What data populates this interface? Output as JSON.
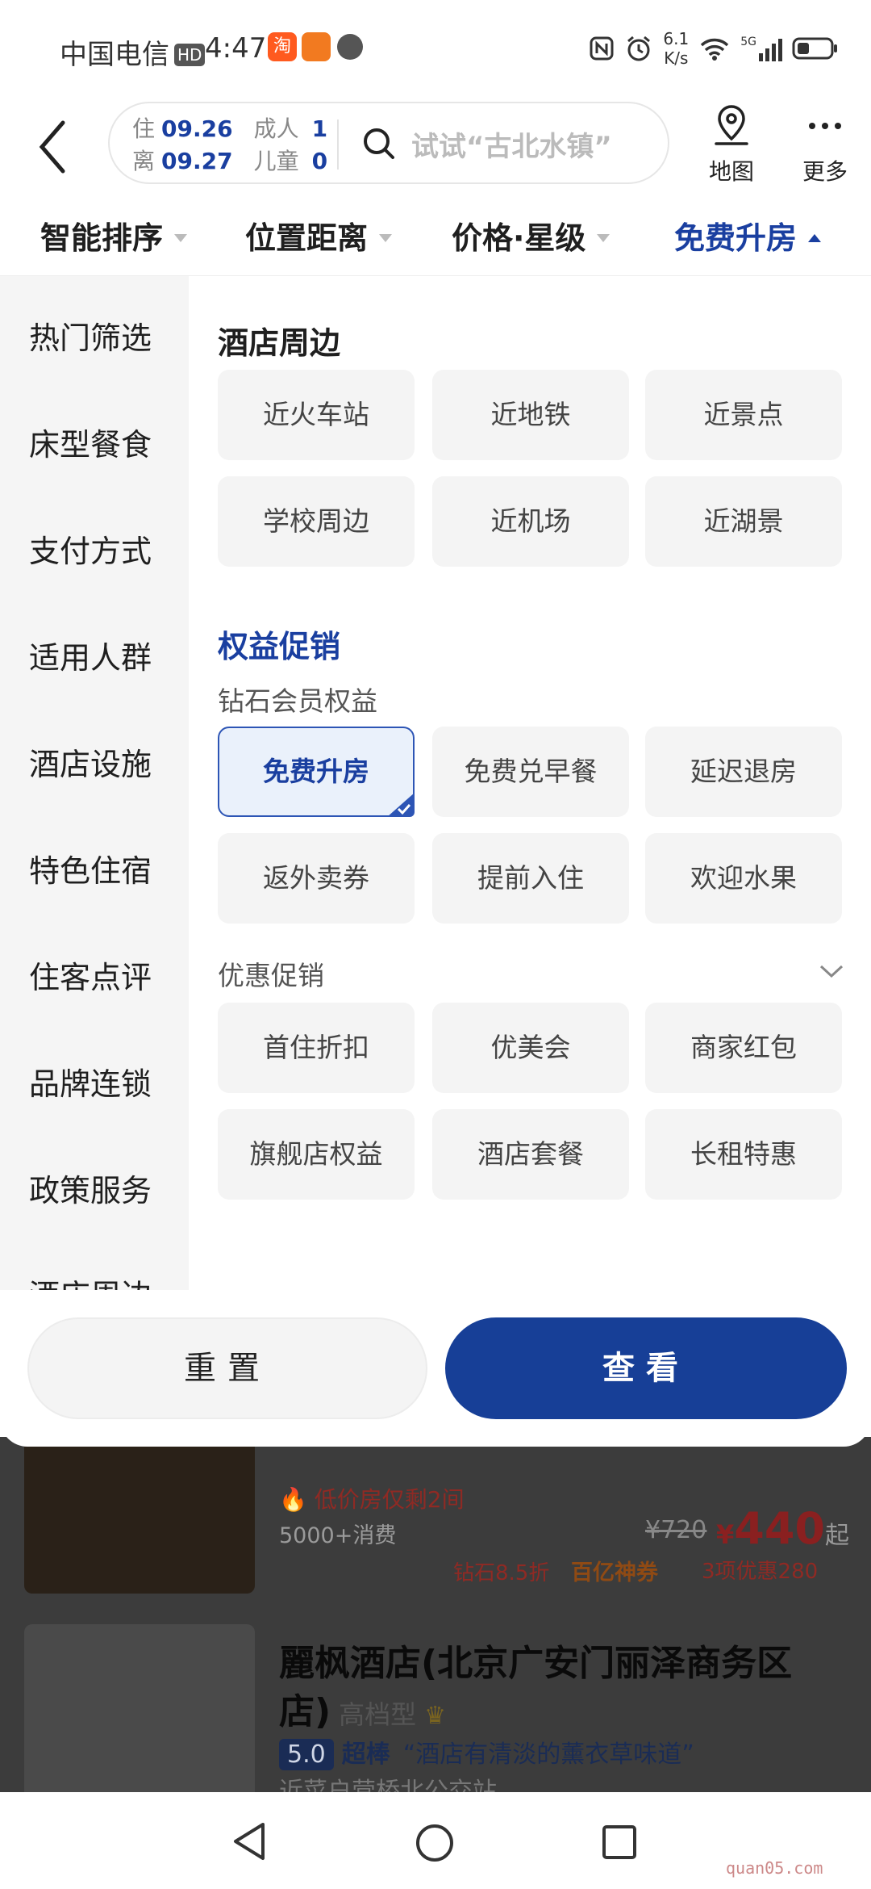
{
  "status_bar": {
    "carrier": "中国电信",
    "hd": "HD",
    "time": "4:47",
    "app_icon_1": "淘",
    "app_icon_2": "",
    "net_speed_value": "6.1",
    "net_speed_unit": "K/s",
    "network": "5G",
    "icons": [
      "nfc-icon",
      "alarm-icon",
      "wifi-icon",
      "signal-icon",
      "battery-icon"
    ]
  },
  "header": {
    "checkin_label": "住",
    "checkin_date": "09.26",
    "checkout_label": "离",
    "checkout_date": "09.27",
    "adults_label": "成人",
    "adults_count": "1",
    "children_label": "儿童",
    "children_count": "0",
    "search_placeholder": "试试“古北水镇”",
    "map_label": "地图",
    "more_label": "更多"
  },
  "sort_tabs": [
    {
      "label": "智能排序",
      "active": false
    },
    {
      "label": "位置距离",
      "active": false
    },
    {
      "label": "价格·星级",
      "active": false
    },
    {
      "label": "免费升房",
      "active": true
    }
  ],
  "filter_categories": [
    "热门筛选",
    "床型餐食",
    "支付方式",
    "适用人群",
    "酒店设施",
    "特色住宿",
    "住客点评",
    "品牌连锁",
    "政策服务",
    "酒店周边"
  ],
  "sections": {
    "surroundings": {
      "title": "酒店周边",
      "chips": [
        "近火车站",
        "近地铁",
        "近景点",
        "学校周边",
        "近机场",
        "近湖景"
      ]
    },
    "benefits": {
      "title": "权益促销",
      "subtitle": "钻石会员权益",
      "chips": [
        "免费升房",
        "免费兑早餐",
        "延迟退房",
        "返外卖券",
        "提前入住",
        "欢迎水果"
      ],
      "selected": "免费升房"
    },
    "promotions": {
      "subtitle": "优惠促销",
      "chips": [
        "首住折扣",
        "优美会",
        "商家红包",
        "旗舰店权益",
        "酒店套餐",
        "长租特惠"
      ]
    }
  },
  "buttons": {
    "reset": "重置",
    "view": "查看"
  },
  "background_list": {
    "item1": {
      "tag": "低价房仅剩2间",
      "consumption": "5000+消费",
      "original_price": "¥720",
      "price_symbol": "¥",
      "price": "440",
      "price_suffix": "起",
      "discount": "钻石8.5折",
      "coupon": "百亿神券",
      "offers": "3项优惠280"
    },
    "item2": {
      "name_line1": "麗枫酒店(北京广安门丽泽商务区",
      "name_line2": "店)",
      "level": "高档型",
      "score": "5.0",
      "score_label": "超棒",
      "review": "“酒店有清淡的薰衣草味道”",
      "location": "近菜户营桥北公交站"
    }
  },
  "watermark": "quan05.com",
  "colors": {
    "accent": "#1a3fa0",
    "primary_button": "#173f97",
    "price_red": "#e8322b"
  }
}
